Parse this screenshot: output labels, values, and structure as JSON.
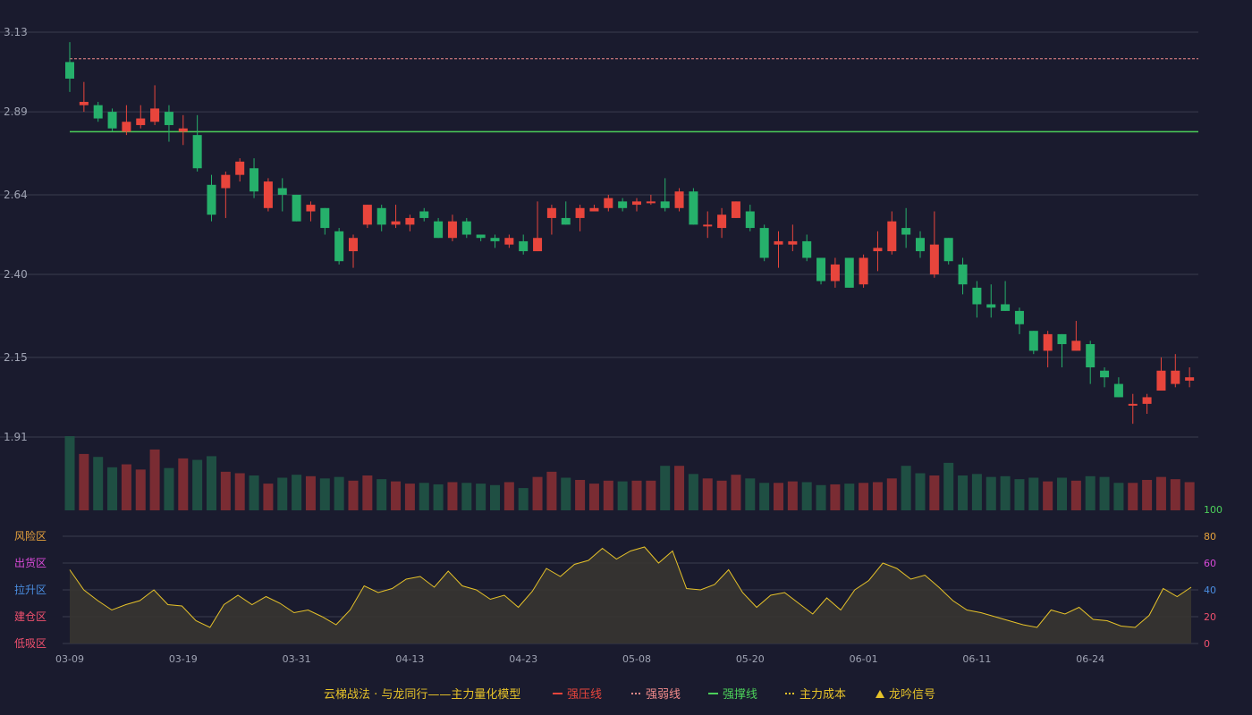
{
  "chart_data": {
    "type": "candlestick",
    "colors": {
      "background": "#1a1b2e",
      "up": "#e8453c",
      "down": "#26b06b",
      "volume_up": "#7a2c33",
      "volume_down": "#1f4f43",
      "grid": "#3a3c4e",
      "axis_text": "#9fa3b3",
      "resistance": "#e8453c",
      "weak_resistance": "#f08a8a",
      "support": "#4cd05a",
      "main_cost": "#e6c229",
      "signal": "#e6c229",
      "osc_fill": "#3a3630",
      "osc_line": "#e6c229",
      "zone_risk": "#e6a23c",
      "zone_ship": "#d84ad8",
      "zone_pull": "#4a8de0",
      "zone_build": "#f0506e",
      "zone_low": "#f0506e"
    },
    "price_axis": {
      "ticks": [
        3.13,
        2.89,
        2.64,
        2.4,
        2.15,
        1.91
      ],
      "min": 1.91,
      "max": 3.13
    },
    "x_ticks": [
      {
        "index": 0,
        "label": "03-09"
      },
      {
        "index": 8,
        "label": "03-19"
      },
      {
        "index": 16,
        "label": "03-31"
      },
      {
        "index": 24,
        "label": "04-13"
      },
      {
        "index": 32,
        "label": "04-23"
      },
      {
        "index": 40,
        "label": "05-08"
      },
      {
        "index": 48,
        "label": "05-20"
      },
      {
        "index": 56,
        "label": "06-01"
      },
      {
        "index": 64,
        "label": "06-11"
      },
      {
        "index": 72,
        "label": "06-24"
      }
    ],
    "lines": {
      "weak_resistance": 3.05,
      "support": 2.83
    },
    "candles": [
      [
        3.04,
        2.99,
        3.1,
        2.95
      ],
      [
        2.91,
        2.92,
        2.98,
        2.89
      ],
      [
        2.91,
        2.87,
        2.92,
        2.86
      ],
      [
        2.89,
        2.84,
        2.9,
        2.83
      ],
      [
        2.83,
        2.86,
        2.91,
        2.82
      ],
      [
        2.85,
        2.87,
        2.91,
        2.84
      ],
      [
        2.86,
        2.9,
        2.97,
        2.85
      ],
      [
        2.89,
        2.85,
        2.91,
        2.8
      ],
      [
        2.83,
        2.84,
        2.88,
        2.79
      ],
      [
        2.82,
        2.72,
        2.88,
        2.71
      ],
      [
        2.67,
        2.58,
        2.7,
        2.56
      ],
      [
        2.66,
        2.7,
        2.71,
        2.57
      ],
      [
        2.7,
        2.74,
        2.75,
        2.68
      ],
      [
        2.72,
        2.65,
        2.75,
        2.63
      ],
      [
        2.6,
        2.68,
        2.69,
        2.59
      ],
      [
        2.66,
        2.64,
        2.69,
        2.59
      ],
      [
        2.64,
        2.56,
        2.64,
        2.56
      ],
      [
        2.59,
        2.61,
        2.62,
        2.56
      ],
      [
        2.6,
        2.54,
        2.6,
        2.52
      ],
      [
        2.53,
        2.44,
        2.54,
        2.43
      ],
      [
        2.47,
        2.51,
        2.52,
        2.42
      ],
      [
        2.55,
        2.61,
        2.61,
        2.54
      ],
      [
        2.6,
        2.55,
        2.61,
        2.53
      ],
      [
        2.55,
        2.56,
        2.61,
        2.54
      ],
      [
        2.55,
        2.57,
        2.58,
        2.53
      ],
      [
        2.59,
        2.57,
        2.6,
        2.56
      ],
      [
        2.56,
        2.51,
        2.57,
        2.51
      ],
      [
        2.51,
        2.56,
        2.58,
        2.5
      ],
      [
        2.56,
        2.52,
        2.57,
        2.51
      ],
      [
        2.52,
        2.51,
        2.52,
        2.5
      ],
      [
        2.51,
        2.5,
        2.52,
        2.48
      ],
      [
        2.49,
        2.51,
        2.52,
        2.48
      ],
      [
        2.5,
        2.47,
        2.52,
        2.46
      ],
      [
        2.47,
        2.51,
        2.62,
        2.47
      ],
      [
        2.57,
        2.6,
        2.61,
        2.52
      ],
      [
        2.57,
        2.55,
        2.62,
        2.55
      ],
      [
        2.57,
        2.6,
        2.61,
        2.53
      ],
      [
        2.59,
        2.6,
        2.61,
        2.59
      ],
      [
        2.6,
        2.63,
        2.64,
        2.59
      ],
      [
        2.62,
        2.6,
        2.63,
        2.59
      ],
      [
        2.61,
        2.62,
        2.63,
        2.59
      ],
      [
        2.62,
        2.62,
        2.64,
        2.61
      ],
      [
        2.62,
        2.6,
        2.69,
        2.59
      ],
      [
        2.6,
        2.65,
        2.66,
        2.59
      ],
      [
        2.65,
        2.55,
        2.66,
        2.55
      ],
      [
        2.55,
        2.55,
        2.59,
        2.51
      ],
      [
        2.54,
        2.58,
        2.6,
        2.51
      ],
      [
        2.57,
        2.62,
        2.62,
        2.57
      ],
      [
        2.59,
        2.54,
        2.61,
        2.53
      ],
      [
        2.54,
        2.45,
        2.55,
        2.44
      ],
      [
        2.49,
        2.5,
        2.53,
        2.42
      ],
      [
        2.49,
        2.5,
        2.55,
        2.47
      ],
      [
        2.5,
        2.45,
        2.52,
        2.44
      ],
      [
        2.45,
        2.38,
        2.45,
        2.37
      ],
      [
        2.38,
        2.43,
        2.45,
        2.36
      ],
      [
        2.45,
        2.36,
        2.45,
        2.36
      ],
      [
        2.37,
        2.45,
        2.46,
        2.36
      ],
      [
        2.47,
        2.48,
        2.53,
        2.41
      ],
      [
        2.47,
        2.56,
        2.59,
        2.46
      ],
      [
        2.54,
        2.52,
        2.6,
        2.48
      ],
      [
        2.51,
        2.47,
        2.53,
        2.45
      ],
      [
        2.4,
        2.49,
        2.59,
        2.39
      ],
      [
        2.51,
        2.44,
        2.51,
        2.43
      ],
      [
        2.43,
        2.37,
        2.45,
        2.34
      ],
      [
        2.36,
        2.31,
        2.38,
        2.27
      ],
      [
        2.31,
        2.3,
        2.37,
        2.27
      ],
      [
        2.31,
        2.29,
        2.38,
        2.29
      ],
      [
        2.29,
        2.25,
        2.3,
        2.22
      ],
      [
        2.23,
        2.17,
        2.23,
        2.16
      ],
      [
        2.17,
        2.22,
        2.23,
        2.12
      ],
      [
        2.22,
        2.19,
        2.22,
        2.12
      ],
      [
        2.17,
        2.2,
        2.26,
        2.17
      ],
      [
        2.19,
        2.12,
        2.2,
        2.07
      ],
      [
        2.11,
        2.09,
        2.12,
        2.06
      ],
      [
        2.07,
        2.03,
        2.09,
        2.03
      ],
      [
        2.01,
        2.01,
        2.04,
        1.95
      ],
      [
        2.01,
        2.03,
        2.04,
        1.98
      ],
      [
        2.05,
        2.11,
        2.15,
        2.05
      ],
      [
        2.07,
        2.11,
        2.16,
        2.06
      ],
      [
        2.08,
        2.09,
        2.12,
        2.06
      ]
    ],
    "volume": [
      100,
      76,
      72,
      58,
      62,
      55,
      82,
      57,
      70,
      68,
      73,
      52,
      50,
      47,
      36,
      44,
      48,
      46,
      43,
      45,
      40,
      47,
      42,
      39,
      36,
      37,
      35,
      38,
      37,
      36,
      34,
      38,
      30,
      45,
      52,
      44,
      41,
      36,
      40,
      39,
      40,
      40,
      60,
      60,
      49,
      43,
      40,
      48,
      43,
      37,
      37,
      39,
      38,
      34,
      35,
      36,
      37,
      38,
      43,
      60,
      50,
      47,
      64,
      47,
      49,
      45,
      46,
      42,
      44,
      39,
      44,
      40,
      46,
      45,
      37,
      37,
      41,
      45,
      42,
      38
    ],
    "oscillator": {
      "ticks": [
        100,
        80,
        60,
        40,
        20,
        0
      ],
      "zones": [
        "风险区",
        "出货区",
        "拉升区",
        "建仓区",
        "低吸区"
      ],
      "values": [
        55,
        40,
        32,
        25,
        29,
        32,
        40,
        29,
        28,
        17,
        12,
        29,
        36,
        29,
        35,
        30,
        23,
        25,
        20,
        14,
        25,
        43,
        38,
        41,
        48,
        50,
        42,
        54,
        43,
        40,
        33,
        36,
        27,
        39,
        56,
        50,
        59,
        62,
        71,
        63,
        69,
        72,
        60,
        69,
        41,
        40,
        44,
        55,
        38,
        27,
        36,
        38,
        30,
        22,
        34,
        25,
        40,
        47,
        60,
        56,
        48,
        51,
        42,
        32,
        25,
        23,
        20,
        17,
        14,
        12,
        25,
        22,
        27,
        18,
        17,
        13,
        12,
        21,
        41,
        35,
        42
      ]
    },
    "legend": {
      "title": "云梯战法 · 与龙同行——主力量化模型",
      "items": [
        {
          "key": "resistance",
          "label": "强压线",
          "glyph": "—"
        },
        {
          "key": "weak_resistance",
          "label": "强弱线",
          "glyph": "---"
        },
        {
          "key": "support",
          "label": "强撑线",
          "glyph": "—"
        },
        {
          "key": "main_cost",
          "label": "主力成本",
          "glyph": "---"
        },
        {
          "key": "signal",
          "label": "龙吟信号",
          "glyph": "▲"
        }
      ]
    }
  }
}
